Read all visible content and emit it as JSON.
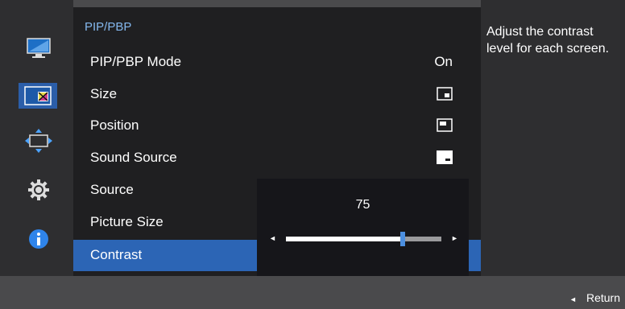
{
  "sidebar": {
    "items": [
      {
        "icon": "picture-icon"
      },
      {
        "icon": "pip-pbp-icon",
        "selected": true
      },
      {
        "icon": "onscreen-display-icon"
      },
      {
        "icon": "system-gear-icon"
      },
      {
        "icon": "information-icon"
      }
    ]
  },
  "menu": {
    "title": "PIP/PBP",
    "items": [
      {
        "label": "PIP/PBP Mode",
        "value": "On"
      },
      {
        "label": "Size",
        "icon": "size-icon"
      },
      {
        "label": "Position",
        "icon": "position-icon"
      },
      {
        "label": "Sound Source",
        "icon": "sound-source-icon"
      },
      {
        "label": "Source"
      },
      {
        "label": "Picture Size"
      },
      {
        "label": "Contrast",
        "selected": true
      }
    ]
  },
  "slider": {
    "value": "75",
    "level": 0.75,
    "left_arrow": "◄",
    "right_arrow": "►"
  },
  "help": {
    "text": "Adjust the contrast level for each screen."
  },
  "footer": {
    "return_arrow": "◄",
    "return_label": "Return"
  },
  "colors": {
    "accent": "#2c65b5",
    "title": "#84b8ee",
    "thumb": "#4c8fe0"
  }
}
